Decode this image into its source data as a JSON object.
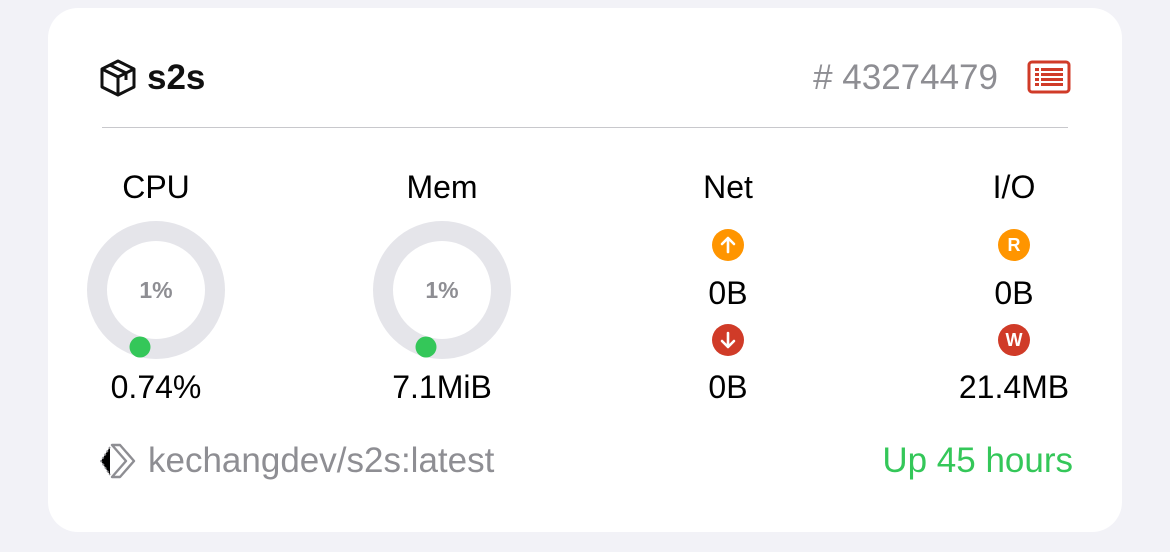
{
  "container": {
    "name": "s2s",
    "id_prefix": "#",
    "id": "43274479",
    "image": "kechangdev/s2s:latest",
    "status": "Up 45 hours"
  },
  "stats": {
    "cpu": {
      "label": "CPU",
      "ring_percent": "1%",
      "value": "0.74%",
      "fraction": 0.0074
    },
    "mem": {
      "label": "Mem",
      "ring_percent": "1%",
      "value": "7.1MiB",
      "fraction": 0.01
    },
    "net": {
      "label": "Net",
      "up_value": "0B",
      "down_value": "0B"
    },
    "io": {
      "label": "I/O",
      "read_badge": "R",
      "read_value": "0B",
      "write_badge": "W",
      "write_value": "21.4MB"
    }
  },
  "colors": {
    "ring_track": "#e5e5ea",
    "ring_progress": "#34c759",
    "orange": "#ff9500",
    "red": "#d03b28",
    "status_green": "#34c759",
    "log_icon": "#d03b28"
  },
  "icons": {
    "container": "cube-icon",
    "logs": "log-list-icon",
    "net_up": "arrow-up-circle-icon",
    "net_down": "arrow-down-circle-icon",
    "image": "docker-image-icon"
  }
}
